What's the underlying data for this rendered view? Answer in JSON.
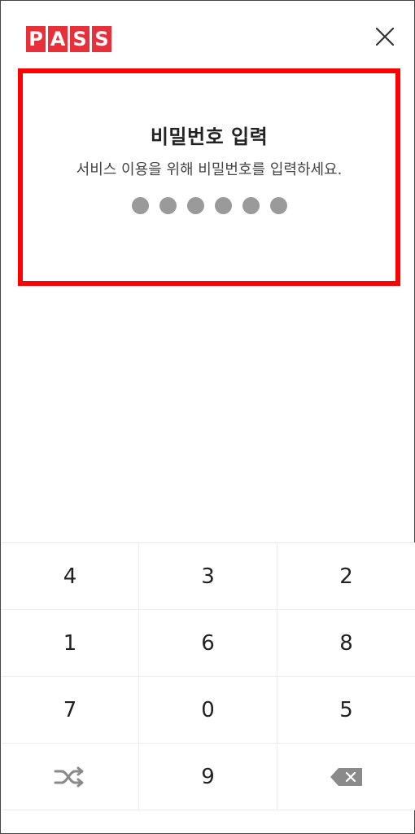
{
  "header": {
    "logo_letters": [
      "P",
      "A",
      "S",
      "S"
    ],
    "logo_color": "#e8303a",
    "close_icon": "close-icon"
  },
  "prompt": {
    "title": "비밀번호 입력",
    "subtitle": "서비스 이용을 위해 비밀번호를 입력하세요.",
    "pin_length": 6,
    "highlight_color": "#ff0000"
  },
  "keypad": {
    "rows": [
      [
        "4",
        "3",
        "2"
      ],
      [
        "1",
        "6",
        "8"
      ],
      [
        "7",
        "0",
        "5"
      ],
      [
        "shuffle",
        "9",
        "backspace"
      ]
    ],
    "shuffle_icon": "shuffle-icon",
    "backspace_icon": "backspace-icon"
  }
}
